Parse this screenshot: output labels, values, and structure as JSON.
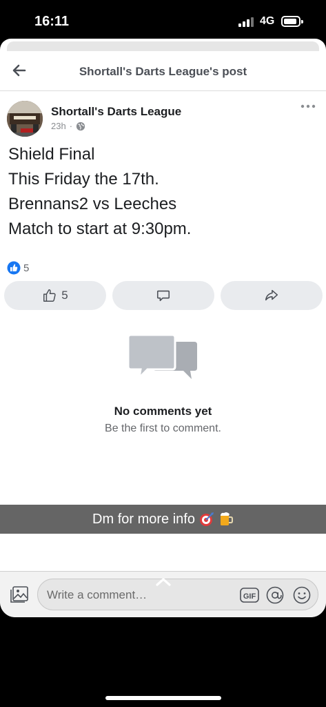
{
  "status": {
    "time": "16:11",
    "network": "4G"
  },
  "header": {
    "title": "Shortall's Darts League's post"
  },
  "post": {
    "author": "Shortall's Darts League",
    "age": "23h",
    "separator": "·",
    "lines": [
      "Shield Final",
      "This Friday the 17th.",
      "Brennans2 vs Leeches",
      "Match to start at 9:30pm."
    ],
    "reaction_count": "5"
  },
  "actions": {
    "like_count": "5"
  },
  "empty_state": {
    "title": "No comments yet",
    "subtitle": "Be the first to comment."
  },
  "caption": {
    "text": "Dm for more info"
  },
  "composer": {
    "placeholder": "Write a comment…",
    "gif_label": "GIF"
  },
  "icons": {
    "back": "back-arrow-icon",
    "globe": "globe-icon",
    "more": "more-horizontal-icon",
    "like": "thumbs-up-icon",
    "comment": "comment-bubble-icon",
    "share": "share-arrow-icon",
    "photo": "photo-icon",
    "gif": "gif-icon",
    "mention": "at-icon",
    "emoji": "smiley-icon"
  },
  "colors": {
    "like_blue": "#1877f2",
    "sheet_bg": "#ffffff",
    "button_bg": "#e9ebee"
  }
}
